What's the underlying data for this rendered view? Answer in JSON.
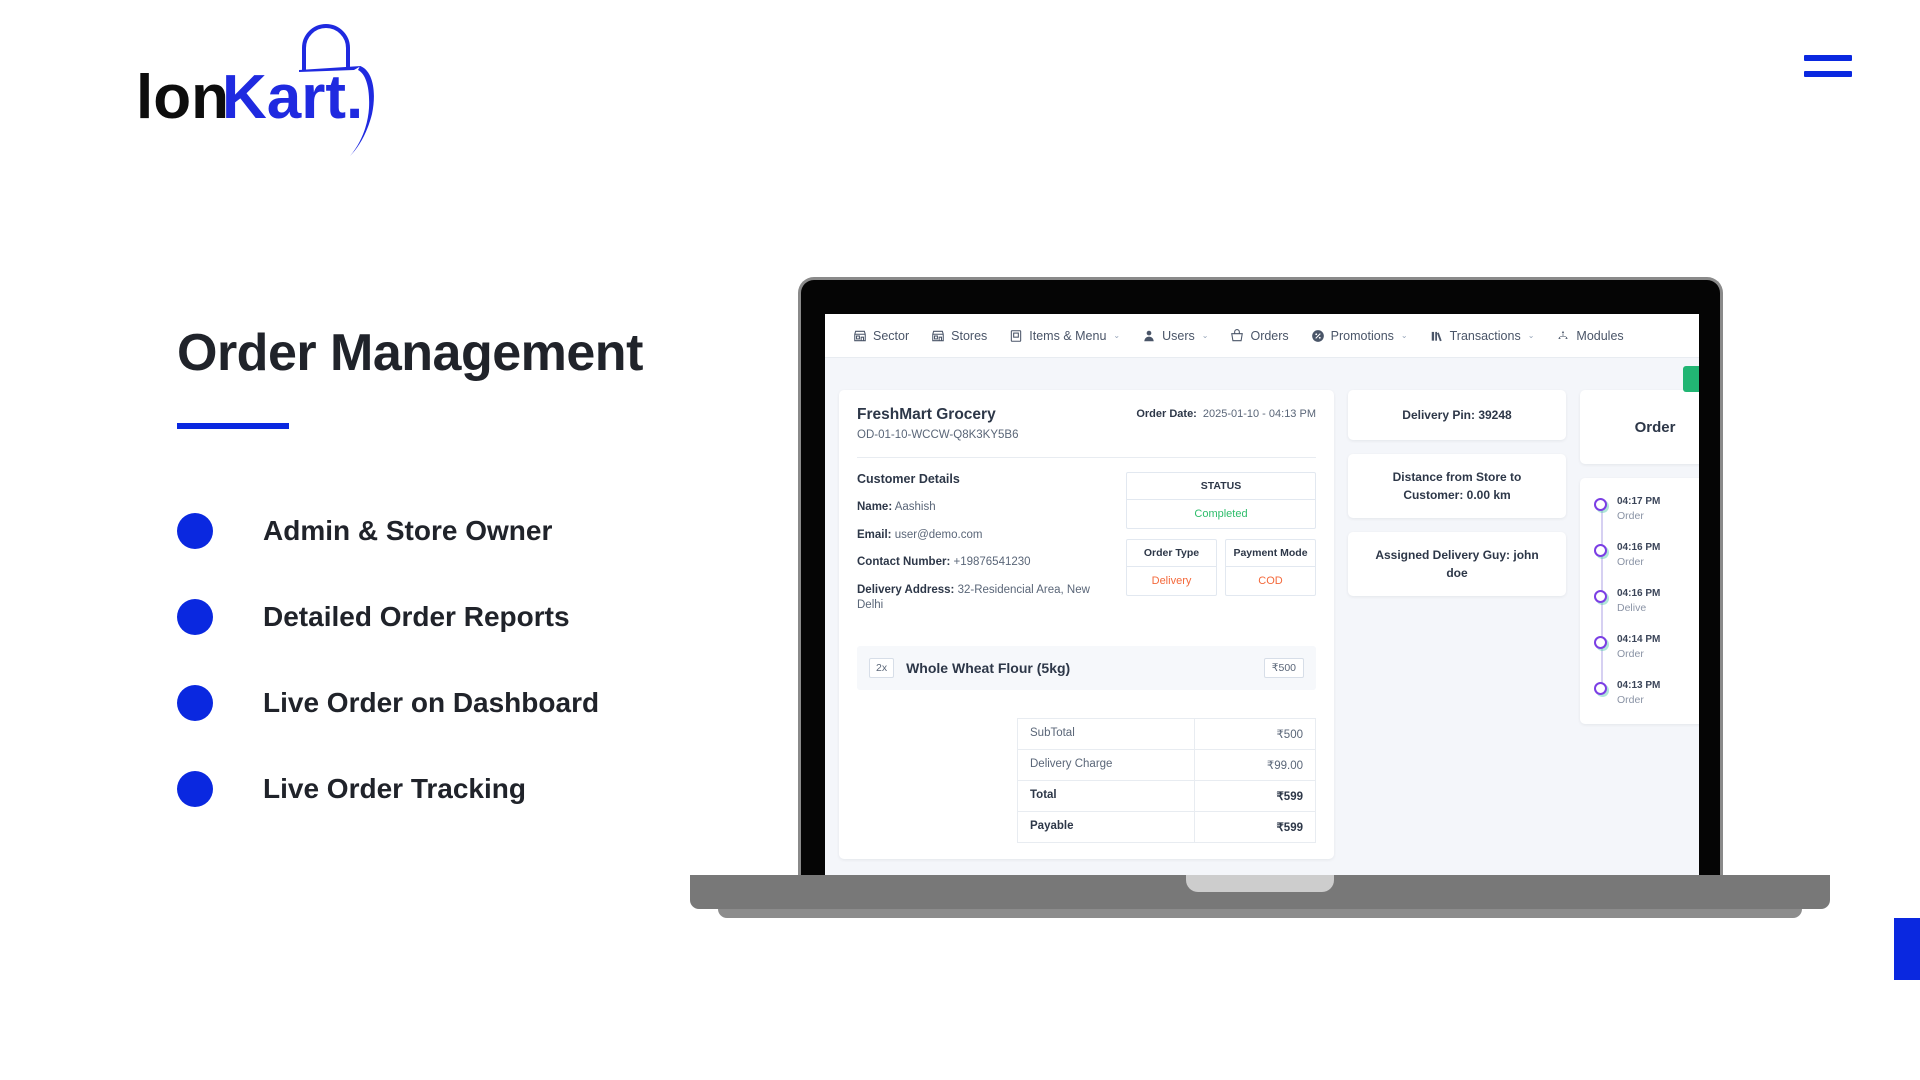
{
  "brand": {
    "name_dark": "Ion",
    "name_blue": "Kart.",
    "logo_alt": "IonKart"
  },
  "nav_toggle": {
    "label": "menu"
  },
  "hero": {
    "headline": "Order Management",
    "features": [
      {
        "label": "Admin & Store Owner"
      },
      {
        "label": "Detailed Order Reports"
      },
      {
        "label": "Live Order on Dashboard"
      },
      {
        "label": "Live Order Tracking"
      }
    ]
  },
  "colors": {
    "brand_blue": "#0a28e0",
    "headline": "#20232a",
    "status_green": "#2ebd6b",
    "accent_orange": "#f4693b",
    "timeline_purple": "#7b3fe4",
    "green_button": "#21b573"
  },
  "app": {
    "nav": [
      {
        "label": "Sector",
        "icon": "store-icon",
        "caret": ""
      },
      {
        "label": "Stores",
        "icon": "store-icon",
        "caret": ""
      },
      {
        "label": "Items & Menu",
        "icon": "menu-board-icon",
        "caret": "⌄"
      },
      {
        "label": "Users",
        "icon": "user-icon",
        "caret": "⌄"
      },
      {
        "label": "Orders",
        "icon": "basket-icon",
        "caret": ""
      },
      {
        "label": "Promotions",
        "icon": "discount-icon",
        "caret": "⌄"
      },
      {
        "label": "Transactions",
        "icon": "books-icon",
        "caret": "⌄"
      },
      {
        "label": "Modules",
        "icon": "modules-icon",
        "caret": ""
      }
    ],
    "order": {
      "store_name": "FreshMart Grocery",
      "order_id": "OD-01-10-WCCW-Q8K3KY5B6",
      "order_date_label": "Order Date:",
      "order_date_value": "2025-01-10 - 04:13 PM",
      "customer": {
        "heading": "Customer Details",
        "rows": [
          {
            "label": "Name:",
            "value": "Aashish"
          },
          {
            "label": "Email:",
            "value": "user@demo.com"
          },
          {
            "label": "Contact Number:",
            "value": "+19876541230"
          },
          {
            "label": "Delivery Address:",
            "value": "32-Residencial Area, New Delhi"
          }
        ]
      },
      "status": {
        "header": "STATUS",
        "value": "Completed"
      },
      "order_type": {
        "header": "Order Type",
        "value": "Delivery"
      },
      "payment_mode": {
        "header": "Payment Mode",
        "value": "COD"
      },
      "item": {
        "qty": "2x",
        "name": "Whole Wheat Flour (5kg)",
        "price": "₹500"
      },
      "totals": [
        {
          "label": "SubTotal",
          "value": "₹500",
          "bold": false
        },
        {
          "label": "Delivery Charge",
          "value": "₹99.00",
          "bold": false
        },
        {
          "label": "Total",
          "value": "₹599",
          "bold": true
        },
        {
          "label": "Payable",
          "value": "₹599",
          "bold": true
        }
      ]
    },
    "info_cards": [
      {
        "text": "Delivery Pin: 39248"
      },
      {
        "text": "Distance from Store to Customer: 0.00 km"
      },
      {
        "text": "Assigned Delivery Guy: john doe"
      }
    ],
    "timeline": {
      "heading": "Order",
      "events": [
        {
          "time": "04:17 PM",
          "label": "Order"
        },
        {
          "time": "04:16 PM",
          "label": "Order"
        },
        {
          "time": "04:16 PM",
          "label": "Delive"
        },
        {
          "time": "04:14 PM",
          "label": "Order"
        },
        {
          "time": "04:13 PM",
          "label": "Order"
        }
      ]
    }
  }
}
